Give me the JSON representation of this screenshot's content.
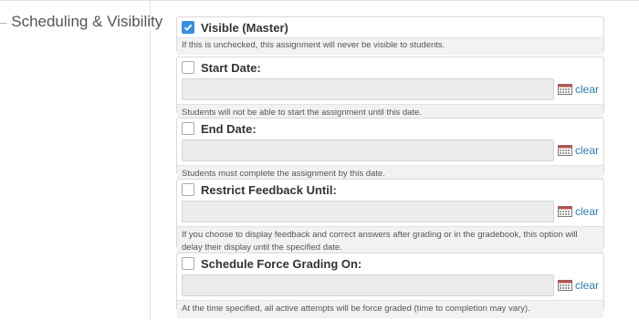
{
  "section": {
    "title": "Scheduling & Visibility"
  },
  "panels": [
    {
      "label": "Visible (Master)",
      "checked": true,
      "has_date": false,
      "help": "If this is unchecked, this assignment will never be visible to students."
    },
    {
      "label": "Start Date:",
      "checked": false,
      "has_date": true,
      "value": "",
      "clear": "clear",
      "help": "Students will not be able to start the assignment until this date."
    },
    {
      "label": "End Date:",
      "checked": false,
      "has_date": true,
      "value": "",
      "clear": "clear",
      "help": "Students must complete the assignment by this date."
    },
    {
      "label": "Restrict Feedback Until:",
      "checked": false,
      "has_date": true,
      "value": "",
      "clear": "clear",
      "help": "If you choose to display feedback and correct answers after grading or in the gradebook, this option will delay their display until the specified date."
    },
    {
      "label": "Schedule Force Grading On:",
      "checked": false,
      "has_date": true,
      "value": "",
      "clear": "clear",
      "help": "At the time specified, all active attempts will be force graded (time to completion may vary)."
    }
  ],
  "icons": {
    "checkbox_checked": "check-icon",
    "calendar": "calendar-icon"
  },
  "colors": {
    "accent": "#3b8de0",
    "link": "#2a7ab0"
  }
}
